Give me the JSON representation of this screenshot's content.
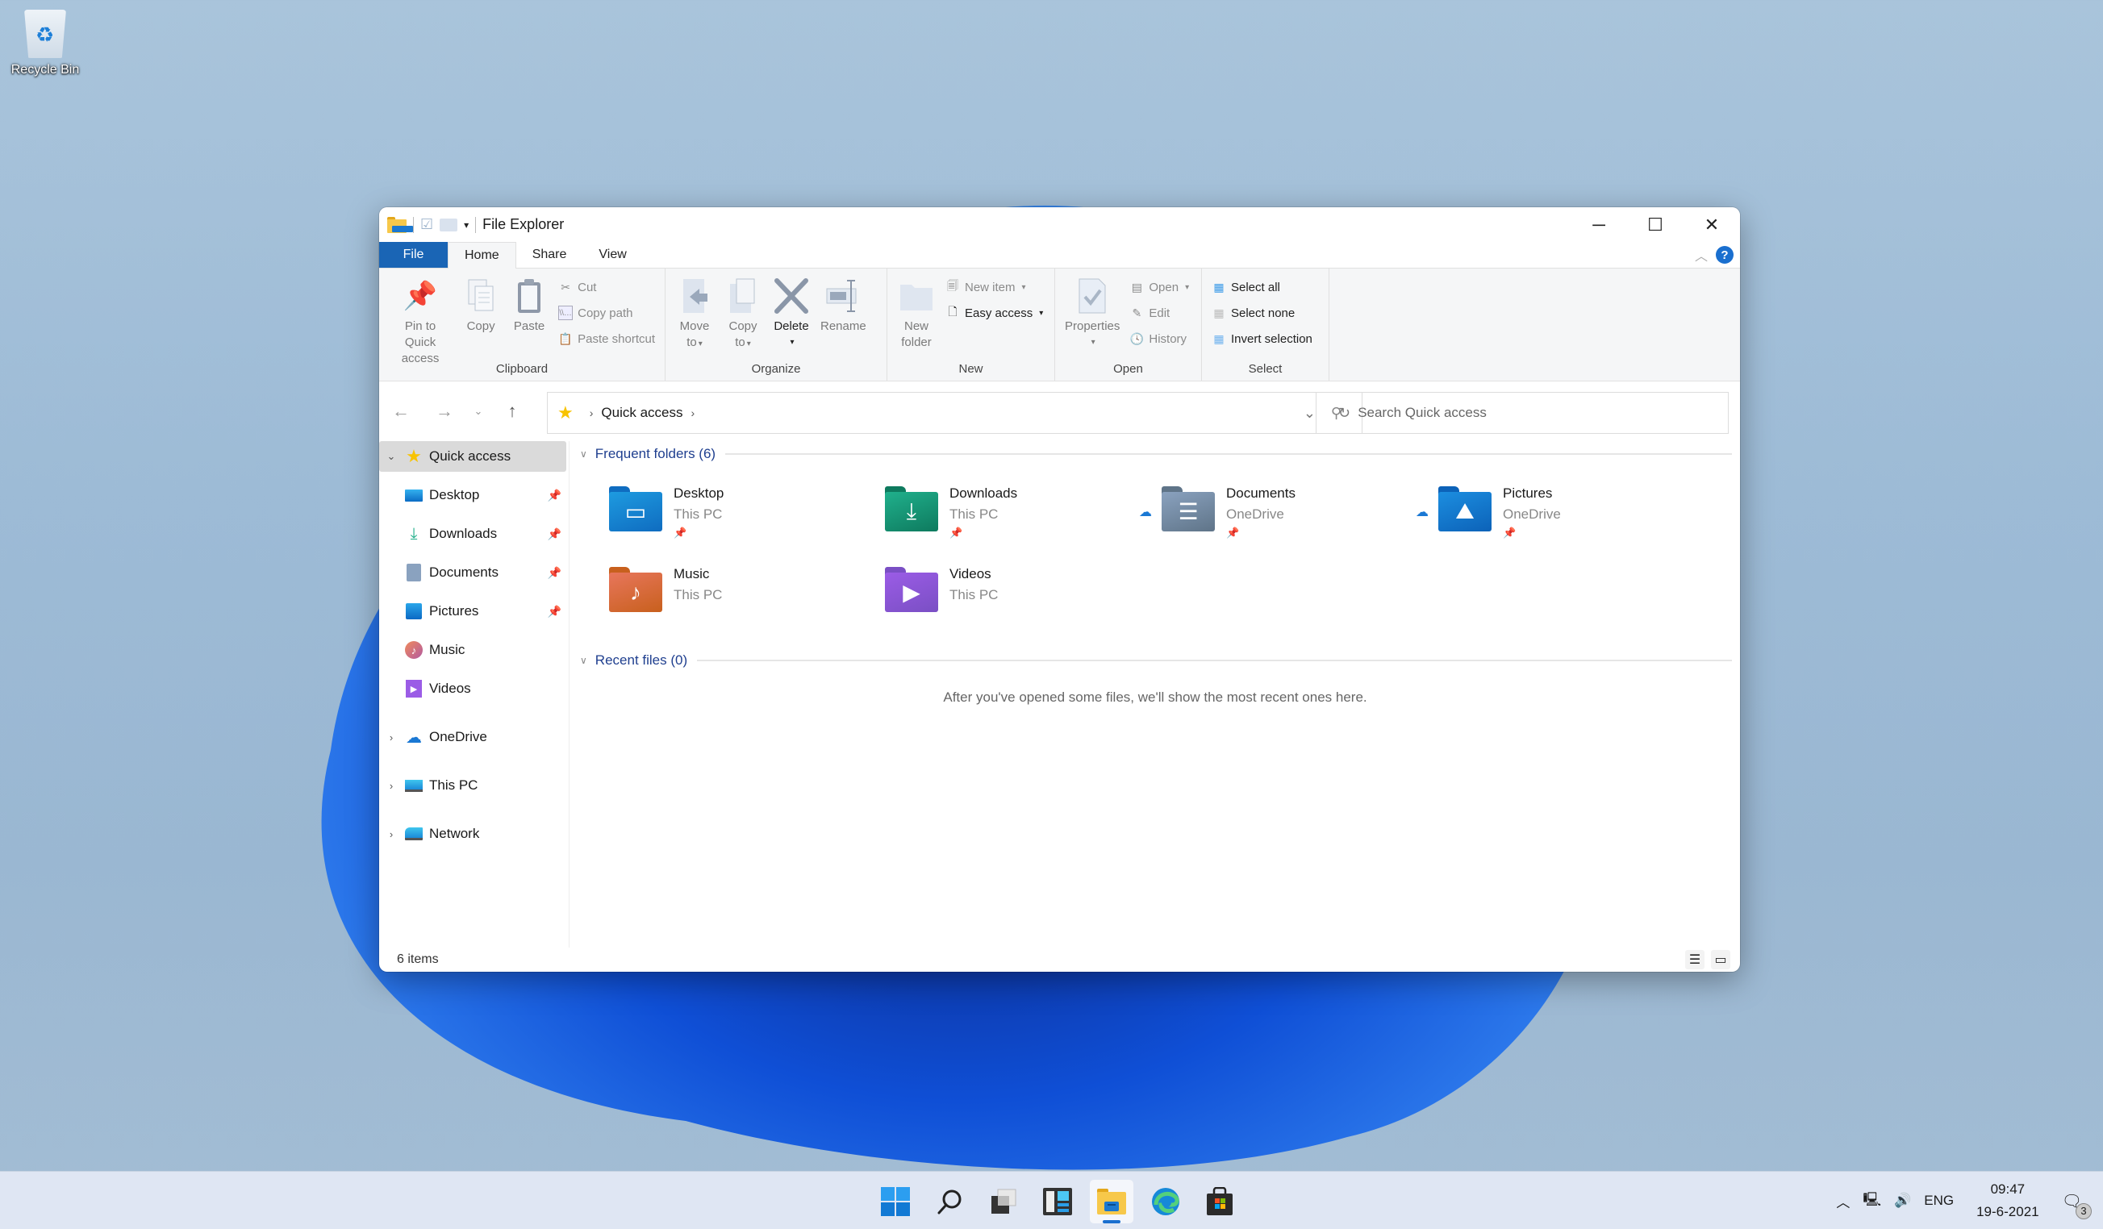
{
  "desktop": {
    "icons": [
      {
        "label": "Recycle Bin",
        "icon": "recycle-bin-icon"
      }
    ]
  },
  "window": {
    "title": "File Explorer",
    "caption": {
      "minimize": "─",
      "maximize": "☐",
      "close": "✕"
    },
    "tabs": [
      {
        "label": "File"
      },
      {
        "label": "Home",
        "active": true
      },
      {
        "label": "Share"
      },
      {
        "label": "View"
      }
    ],
    "help_label": "?",
    "ribbon": {
      "clipboard": {
        "label": "Clipboard",
        "pin_line1": "Pin to Quick",
        "pin_line2": "access",
        "copy": "Copy",
        "paste": "Paste",
        "cut": "Cut",
        "copy_path": "Copy path",
        "paste_shortcut": "Paste shortcut"
      },
      "organize": {
        "label": "Organize",
        "move_line1": "Move",
        "move_line2": "to",
        "copy_line1": "Copy",
        "copy_line2": "to",
        "delete": "Delete",
        "rename": "Rename"
      },
      "new": {
        "label": "New",
        "folder_line1": "New",
        "folder_line2": "folder",
        "new_item": "New item",
        "easy_access": "Easy access"
      },
      "open": {
        "label": "Open",
        "properties": "Properties",
        "open": "Open",
        "edit": "Edit",
        "history": "History"
      },
      "select": {
        "label": "Select",
        "select_all": "Select all",
        "select_none": "Select none",
        "invert": "Invert selection"
      }
    },
    "address": {
      "path": [
        "Quick access"
      ],
      "search_placeholder": "Search Quick access"
    },
    "sidebar": {
      "items": [
        {
          "label": "Quick access",
          "icon": "star-icon",
          "selected": true,
          "expanded": true
        },
        {
          "label": "Desktop",
          "icon": "desktop-icon",
          "pinned": true
        },
        {
          "label": "Downloads",
          "icon": "downloads-icon",
          "pinned": true
        },
        {
          "label": "Documents",
          "icon": "documents-icon",
          "pinned": true
        },
        {
          "label": "Pictures",
          "icon": "pictures-icon",
          "pinned": true
        },
        {
          "label": "Music",
          "icon": "music-icon"
        },
        {
          "label": "Videos",
          "icon": "videos-icon"
        },
        {
          "label": "OneDrive",
          "icon": "onedrive-icon"
        },
        {
          "label": "This PC",
          "icon": "this-pc-icon"
        },
        {
          "label": "Network",
          "icon": "network-icon"
        }
      ]
    },
    "content": {
      "frequent_header": "Frequent folders (6)",
      "folders": [
        {
          "name": "Desktop",
          "location": "This PC",
          "pinned": true,
          "color": "#1e9be0",
          "tab": "#0f6cc0"
        },
        {
          "name": "Downloads",
          "location": "This PC",
          "pinned": true,
          "color": "#20b08c",
          "tab": "#0e7a5e"
        },
        {
          "name": "Documents",
          "location": "OneDrive",
          "pinned": true,
          "cloud": true,
          "color": "#8aa2bf",
          "tab": "#5f7488"
        },
        {
          "name": "Pictures",
          "location": "OneDrive",
          "pinned": true,
          "cloud": true,
          "color": "#1c8ee0",
          "tab": "#0c62b8"
        },
        {
          "name": "Music",
          "location": "This PC",
          "color": "#e8765c",
          "tab": "#c8601d"
        },
        {
          "name": "Videos",
          "location": "This PC",
          "color": "#9b5ce6",
          "tab": "#7a4fc4"
        }
      ],
      "recent_header": "Recent files (0)",
      "recent_empty": "After you've opened some files, we'll show the most recent ones here."
    },
    "status": {
      "items_count": "6 items"
    }
  },
  "taskbar": {
    "apps": [
      "start",
      "search",
      "task-view",
      "widgets",
      "file-explorer",
      "edge",
      "store"
    ],
    "active_app": "file-explorer",
    "tray": {
      "language": "ENG",
      "time": "09:47",
      "date": "19-6-2021",
      "notifications": "3"
    }
  }
}
